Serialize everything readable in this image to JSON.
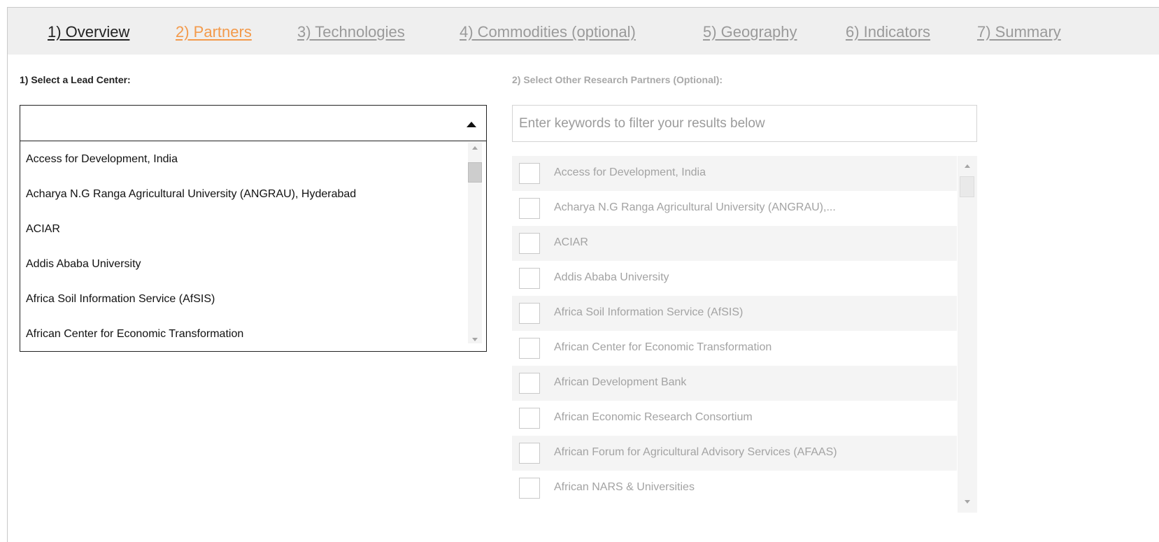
{
  "tabs": [
    {
      "label": "1) Overview",
      "state": "done"
    },
    {
      "label": "2) Partners",
      "state": "active"
    },
    {
      "label": "3) Technologies",
      "state": "inactive"
    },
    {
      "label": "4) Commodities (optional)",
      "state": "inactive"
    },
    {
      "label": "5) Geography",
      "state": "inactive"
    },
    {
      "label": "6) Indicators",
      "state": "inactive"
    },
    {
      "label": "7) Summary",
      "state": "inactive"
    }
  ],
  "colors": {
    "active_tab": "#f39a4b",
    "done_tab": "#222222",
    "inactive_tab": "#9a9a9a",
    "tabbar_bg": "#efefef"
  },
  "lead_center": {
    "label": "1) Select a Lead Center:",
    "value": "",
    "options": [
      "Access for Development, India",
      "Acharya N.G Ranga Agricultural University (ANGRAU), Hyderabad",
      "ACIAR",
      "Addis Ababa University",
      "Africa Soil Information Service (AfSIS)",
      "African Center for Economic Transformation"
    ]
  },
  "partners": {
    "label": "2) Select Other Research Partners (Optional):",
    "filter_placeholder": "Enter keywords to filter your results below",
    "items": [
      "Access for Development, India",
      "Acharya N.G Ranga Agricultural University (ANGRAU),...",
      "ACIAR",
      "Addis Ababa University",
      "Africa Soil Information Service (AfSIS)",
      "African Center for Economic Transformation",
      "African Development Bank",
      "African Economic Research Consortium",
      "African Forum for Agricultural Advisory Services (AFAAS)",
      "African NARS & Universities"
    ]
  }
}
